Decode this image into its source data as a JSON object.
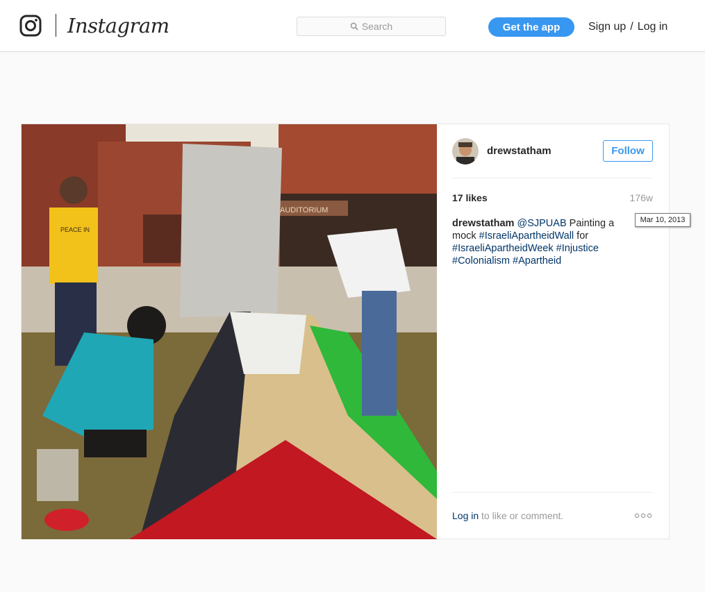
{
  "header": {
    "brand": "Instagram",
    "search_placeholder": "Search",
    "get_app_label": "Get the app",
    "signup_label": "Sign up",
    "separator": "/",
    "login_label": "Log in"
  },
  "post": {
    "username": "drewstatham",
    "follow_label": "Follow",
    "likes": "17 likes",
    "age": "176w",
    "tooltip_date": "Mar 10, 2013",
    "caption": {
      "user": "drewstatham",
      "mention": "@SJPUAB",
      "text1": " Painting a mock ",
      "tag1": "#IsraeliApartheidWall",
      "text2": " for ",
      "tag2": "#IsraeliApartheidWeek",
      "tag3": "#Injustice",
      "tag4": "#Colonialism",
      "tag5": "#Apartheid"
    },
    "login_link": "Log in",
    "login_rest": " to like or comment.",
    "photo_sign": "AUDITORIUM",
    "shirt_text": "PEACE IN"
  },
  "colors": {
    "accent": "#3897f0",
    "link": "#003569",
    "border": "#dbdbdb"
  },
  "icons": [
    "instagram-glyph-icon",
    "search-icon",
    "more-options-icon"
  ]
}
